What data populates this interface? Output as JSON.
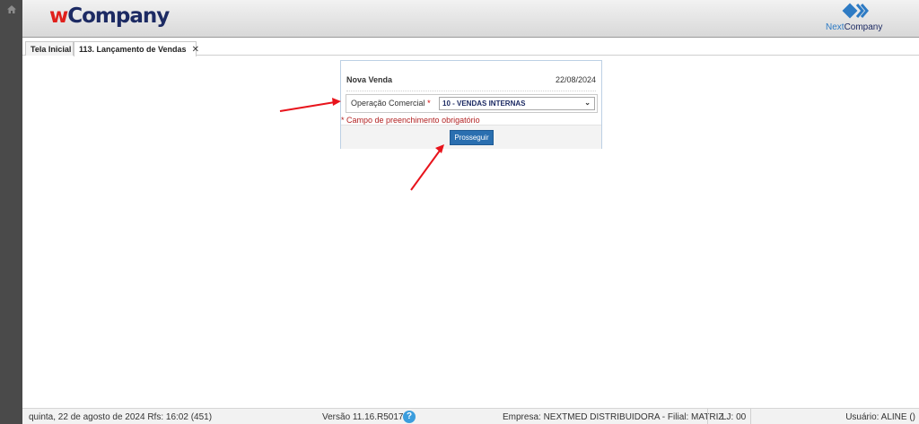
{
  "header": {
    "logo_w": "w",
    "logo_rest": "Company",
    "brand_next": "Next",
    "brand_company": "Company"
  },
  "tabs": [
    {
      "label": "Tela Inicial"
    },
    {
      "label": "113. Lançamento de Vendas",
      "close": "✕"
    }
  ],
  "form": {
    "title": "Nova Venda",
    "date": "22/08/2024",
    "operacao_label": "Operação Comercial",
    "required_mark": "*",
    "operacao_value": "10 - VENDAS INTERNAS",
    "error": "* Campo de preenchimento obrigatório",
    "submit_label": "Prosseguir"
  },
  "status": {
    "date": "quinta, 22 de agosto de 2024  Rfs: 16:02 (451)",
    "version": "Versão 11.16.R5017",
    "help": "?",
    "empresa": "Empresa: NEXTMED DISTRIBUIDORA - Filial: MATRIZ",
    "lj": "LJ: 00",
    "usuario": "Usuário: ALINE ()"
  },
  "colors": {
    "sidebar": "#4a4a4a",
    "button": "#2a6fb0",
    "error": "#b22222",
    "arrow": "#e8141c",
    "brand_red": "#e0201c",
    "brand_navy": "#1c2a63"
  }
}
